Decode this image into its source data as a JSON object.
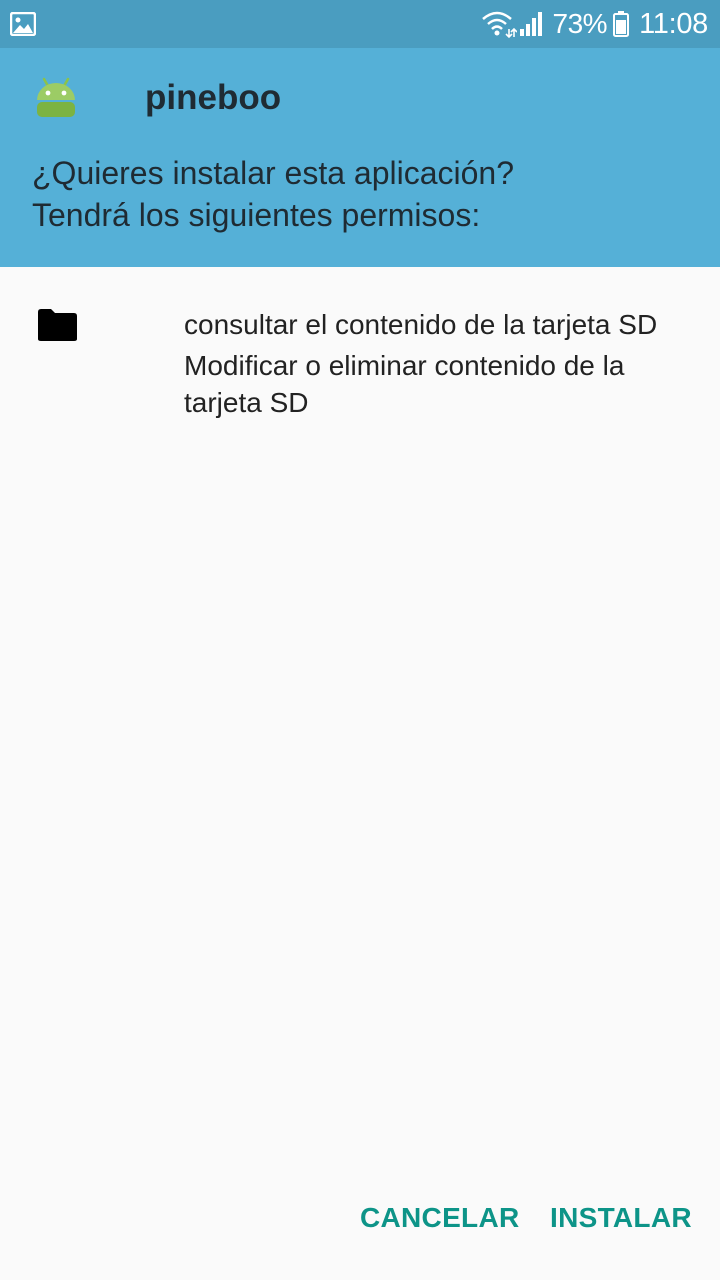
{
  "status_bar": {
    "battery_percent": "73%",
    "time": "11:08",
    "icons": [
      "gallery-icon",
      "wifi-icon",
      "signal-icon",
      "battery-icon"
    ],
    "background": "#4a9dc0"
  },
  "header": {
    "app_name": "pineboo",
    "question": "¿Quieres instalar esta aplicación?",
    "subtitle": "Tendrá los siguientes permisos:",
    "background": "#55b0d7",
    "app_icon": "android-icon"
  },
  "permissions": {
    "group_icon": "folder-icon",
    "items": [
      {
        "label": "consultar el contenido de la tarjeta SD"
      },
      {
        "label": "Modificar o eliminar contenido de la tarjeta SD"
      }
    ]
  },
  "actions": {
    "cancel_label": "CANCELAR",
    "install_label": "INSTALAR",
    "accent": "#0d9488"
  }
}
